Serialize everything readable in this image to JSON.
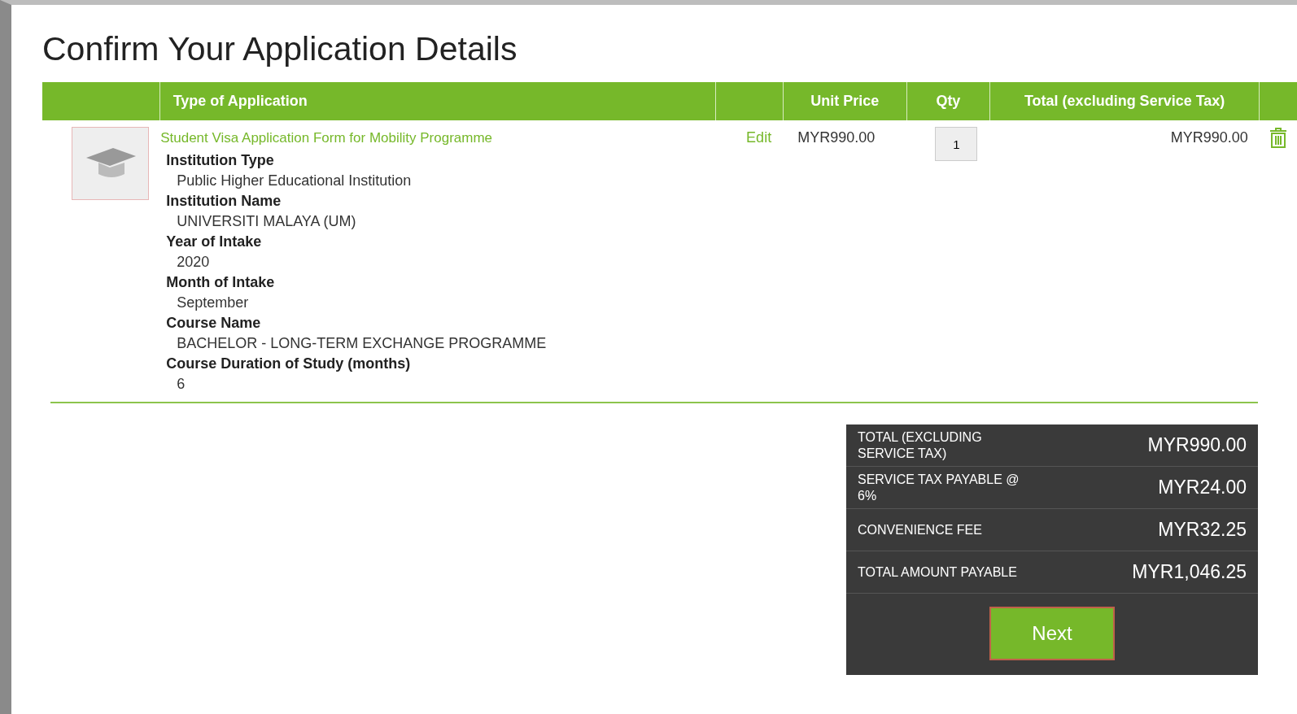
{
  "page": {
    "title": "Confirm Your Application Details"
  },
  "table": {
    "columns": [
      "",
      "Type of Application",
      "",
      "Unit Price",
      "Qty",
      "Total (excluding Service Tax)",
      ""
    ],
    "rows": [
      {
        "title": "Student Visa Application Form for Mobility Programme",
        "edit": "Edit",
        "unit_price": "MYR990.00",
        "qty": "1",
        "total": "MYR990.00",
        "details": [
          {
            "label": "Institution Type",
            "value": "Public Higher Educational Institution"
          },
          {
            "label": "Institution Name",
            "value": "UNIVERSITI MALAYA (UM)"
          },
          {
            "label": "Year of Intake",
            "value": "2020"
          },
          {
            "label": "Month of Intake",
            "value": "September"
          },
          {
            "label": "Course Name",
            "value": "BACHELOR - LONG-TERM EXCHANGE PROGRAMME"
          },
          {
            "label": "Course Duration of Study (months)",
            "value": "6"
          }
        ]
      }
    ]
  },
  "summary": {
    "rows": [
      {
        "label": "TOTAL (EXCLUDING SERVICE TAX)",
        "value": "MYR990.00"
      },
      {
        "label": "SERVICE TAX PAYABLE @ 6%",
        "value": "MYR24.00"
      },
      {
        "label": "CONVENIENCE FEE",
        "value": "MYR32.25"
      },
      {
        "label": "TOTAL AMOUNT PAYABLE",
        "value": "MYR1,046.25"
      }
    ],
    "button": "Next"
  }
}
